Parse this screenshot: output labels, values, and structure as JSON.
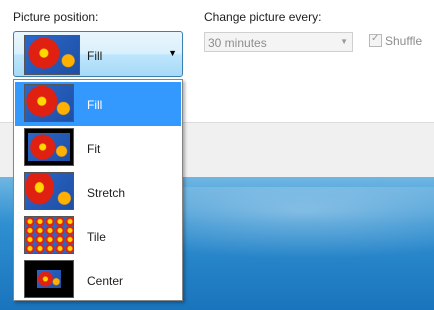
{
  "picture_position": {
    "label": "Picture position:",
    "selected": "Fill",
    "selected_icon": "fill-preview-icon",
    "options": [
      {
        "label": "Fill",
        "icon": "fill-preview-icon",
        "selected": true
      },
      {
        "label": "Fit",
        "icon": "fit-preview-icon",
        "selected": false
      },
      {
        "label": "Stretch",
        "icon": "stretch-preview-icon",
        "selected": false
      },
      {
        "label": "Tile",
        "icon": "tile-preview-icon",
        "selected": false
      },
      {
        "label": "Center",
        "icon": "center-preview-icon",
        "selected": false
      }
    ]
  },
  "change_picture": {
    "label": "Change picture every:",
    "value": "30 minutes",
    "enabled": false
  },
  "shuffle": {
    "label": "Shuffle",
    "checked": true,
    "enabled": false
  },
  "colors": {
    "selection": "#3399ff",
    "combo_border": "#3c7fb1",
    "disabled_text": "#8d8d8d"
  }
}
